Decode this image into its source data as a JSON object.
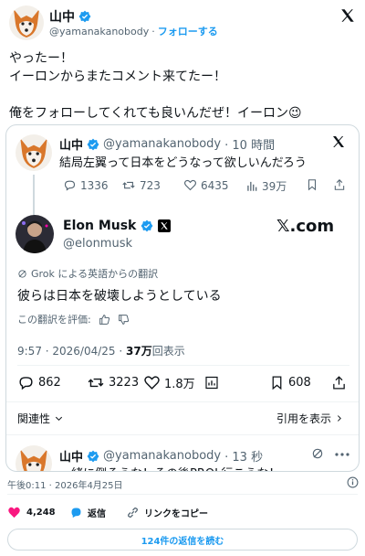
{
  "outer_tweet": {
    "author_name": "山中",
    "handle": "@yamanakanobody",
    "follow_label": "フォローする",
    "separator": "·",
    "body_lines": [
      "やったー！",
      "イーロンからまたコメント来てたー！",
      "俺をフォローしてくれても良いんだぜ！イーロン😉"
    ],
    "timestamp": "午後0:11 · 2026年4月25日",
    "likes": "4,248",
    "reply_label": "返信",
    "copy_link_label": "リンクをコピー",
    "read_replies_label": "124件の返信を読む"
  },
  "quoted_tweet": {
    "author_name": "山中",
    "handle": "@yamanakanobody",
    "time": "· 10 時間",
    "text": "結局左翼って日本をどうなって欲しいんだろう",
    "replies": "1336",
    "retweets": "723",
    "likes": "6435",
    "views": "39万"
  },
  "musk_reply": {
    "author_name": "Elon Musk",
    "handle": "@elonmusk",
    "brand": "𝕏.com",
    "grok_line": "Grok による英語からの翻訳",
    "text": "彼らは日本を破壊しようとしている",
    "rate_translation": "この翻訳を評価:",
    "meta_time": "9:57 · 2026/04/25 · ",
    "meta_views": "37万",
    "meta_views_suffix": "回表示",
    "replies": "862",
    "retweets": "3223",
    "likes": "1.8万",
    "bookmarks": "608",
    "related_label": "関連性",
    "quotes_label": "引用を表示"
  },
  "bottom_tweet": {
    "author_name": "山中",
    "handle": "@yamanakanobody",
    "time": "· 13 秒",
    "partial_text": "一緒に倒そうな！その後PROL行こうな！"
  },
  "colors": {
    "accent": "#1d9bf0",
    "like_red": "#f91880",
    "text": "#0f1419",
    "muted": "#536471",
    "border": "#cfd9de"
  }
}
